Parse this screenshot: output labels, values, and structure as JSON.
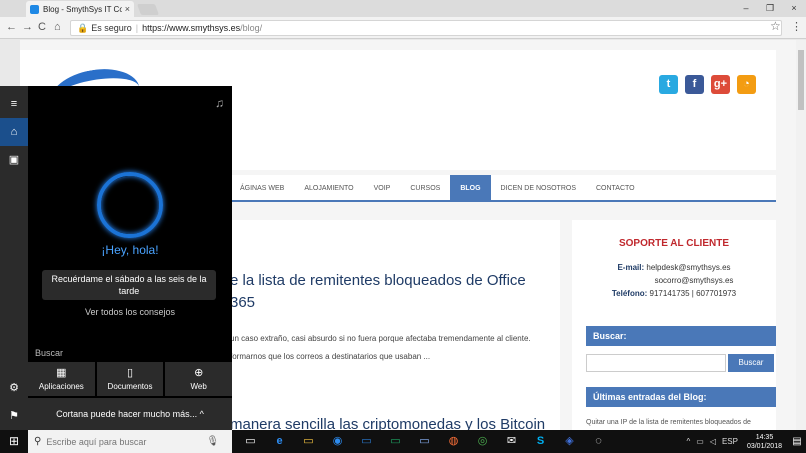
{
  "browser": {
    "tab_title": "Blog - SmythSys IT Cons",
    "tab_close": "×",
    "window_controls": [
      "–",
      "❐",
      "×"
    ],
    "address": {
      "lock": "🔒",
      "secure_label": "Es seguro",
      "separator": "|",
      "host": "https://www.smythsys.es",
      "path": "/blog/"
    },
    "nav": {
      "back": "←",
      "forward": "→",
      "reload": "C",
      "home": "⌂"
    },
    "star": "☆",
    "menu": "⋮"
  },
  "site": {
    "social": [
      {
        "label": "t",
        "color": "#29a9e1"
      },
      {
        "label": "f",
        "color": "#3b5998"
      },
      {
        "label": "g+",
        "color": "#dd4b39"
      },
      {
        "label": "◔",
        "color": "#f39c12"
      }
    ],
    "nav": [
      "ÁGINAS WEB",
      "ALOJAMIENTO",
      "VOIP",
      "CURSOS",
      "BLOG",
      "DICEN DE NOSOTROS",
      "CONTACTO"
    ],
    "nav_active": "BLOG",
    "post": {
      "title_line1": "e la lista de remitentes bloqueados de Office",
      "title_line2": "365",
      "text_line1": "un caso extraño, casi absurdo si no fuera porque afectaba tremendamente al cliente.",
      "text_line2": "formarnos que los correos a destinatarios que usaban ...",
      "title2": "manera sencilla las criptomonedas y los Bitcoin"
    },
    "support": {
      "title": "SOPORTE AL CLIENTE",
      "email_label": "E-mail:",
      "email1": "helpdesk@smythsys.es",
      "email2": "socorro@smythsys.es",
      "phone_label": "Teléfono:",
      "phone": "917141735 | 607701973"
    },
    "search_head": "Buscar:",
    "search_button": "Buscar",
    "latest_head": "Últimas entradas del Blog:",
    "latest_entry": "Quitar una IP de la lista de remitentes bloqueados de"
  },
  "cortana": {
    "greeting": "¡Hey, hola!",
    "tip": "Recuérdame el sábado a las seis de la tarde",
    "all_tips": "Ver todos los consejos",
    "search_label": "Buscar",
    "categories": [
      {
        "icon": "▦",
        "label": "Aplicaciones"
      },
      {
        "icon": "▯",
        "label": "Documentos"
      },
      {
        "icon": "⊕",
        "label": "Web"
      }
    ],
    "more": "Cortana puede hacer mucho más... ^",
    "rail": [
      "≡",
      "⌂",
      "▣",
      "⚙",
      "⚑"
    ],
    "music_icon": "♫"
  },
  "taskbar": {
    "start": "⊞",
    "search_placeholder": "Escribe aquí para buscar",
    "search_glyph": "⚲",
    "mic": "🎙",
    "apps": [
      "▭",
      "e",
      "▭",
      "◉",
      "▭",
      "▭",
      "▭",
      "◍",
      "◎",
      "✉",
      "S",
      "◈",
      "◌"
    ],
    "tray_icons": [
      "^",
      "▭",
      "◁",
      "ESP"
    ],
    "time": "14:35",
    "date": "03/01/2018",
    "notification": "▤"
  }
}
